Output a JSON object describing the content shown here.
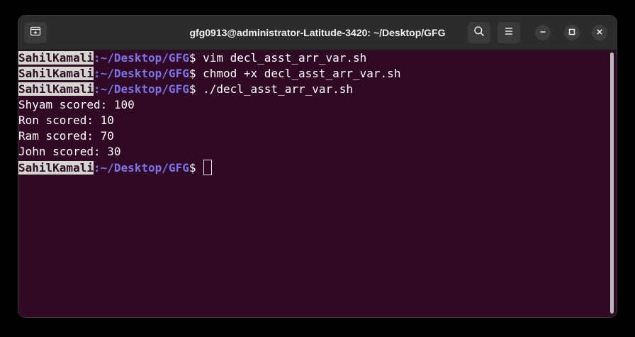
{
  "window": {
    "title": "gfg0913@administrator-Latitude-3420: ~/Desktop/GFG"
  },
  "icons": {
    "new_tab": "new-tab-icon",
    "search": "search-icon",
    "menu": "hamburger-menu-icon",
    "minimize": "minimize-icon",
    "maximize": "maximize-icon",
    "close": "close-icon"
  },
  "colors": {
    "terminal_bg": "#300a24",
    "prompt_user_bg": "#d3d7cf",
    "prompt_path": "#7b74ea",
    "titlebar_bg": "#2c2c2c"
  },
  "prompt": {
    "user": "SahilKamali",
    "path": ":~/Desktop/GFG",
    "symbol": "$ "
  },
  "terminal": {
    "lines": [
      {
        "kind": "prompt",
        "command": "vim decl_asst_arr_var.sh"
      },
      {
        "kind": "prompt",
        "command": "chmod +x decl_asst_arr_var.sh"
      },
      {
        "kind": "prompt",
        "command": "./decl_asst_arr_var.sh"
      },
      {
        "kind": "output",
        "text": "Shyam scored: 100"
      },
      {
        "kind": "output",
        "text": "Ron scored: 10"
      },
      {
        "kind": "output",
        "text": "Ram scored: 70"
      },
      {
        "kind": "output",
        "text": "John scored: 30"
      },
      {
        "kind": "prompt",
        "command": ""
      }
    ]
  }
}
